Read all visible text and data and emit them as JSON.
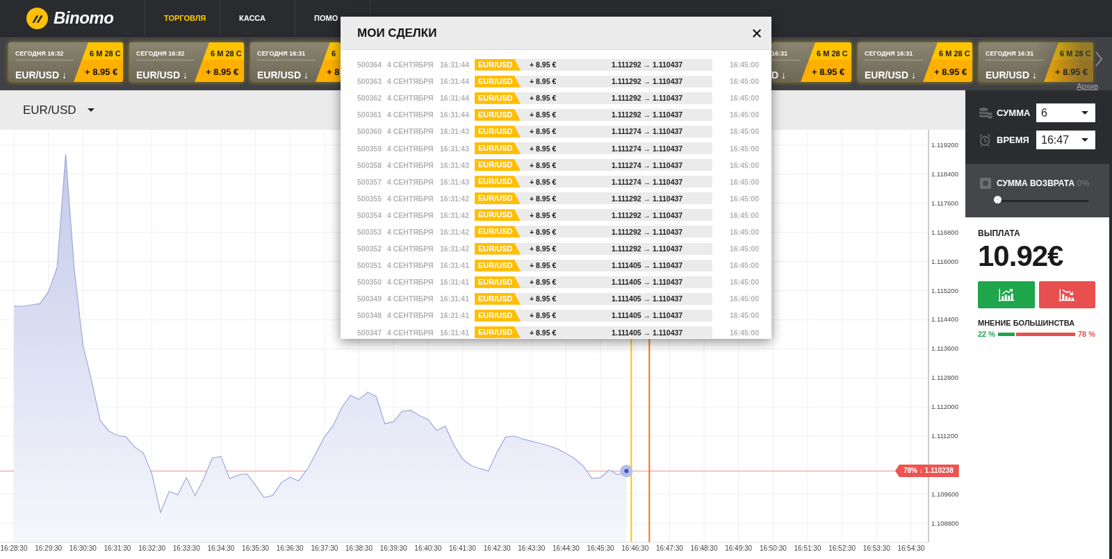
{
  "nav": {
    "logo": "Binomo",
    "items": [
      {
        "label": "ТОРГОВЛЯ",
        "selected": true
      },
      {
        "label": "КАССА",
        "selected": false
      },
      {
        "label": "ПОМО",
        "selected": false
      }
    ]
  },
  "ticker": {
    "left_cards": [
      {
        "kind": "full",
        "date": "СЕГОДНЯ 16:32",
        "timer": "6 М 28 С",
        "pair": "EUR/USD ↓",
        "profit": "+ 8.95 €"
      },
      {
        "kind": "full",
        "date": "СЕГОДНЯ 16:32",
        "timer": "6 М 28 С",
        "pair": "EUR/USD ↓",
        "profit": "+ 8.95 €"
      },
      {
        "kind": "clip-right",
        "date": "СЕГОДНЯ 16:31",
        "timer": "6",
        "pair": "EUR/USD ↓",
        "profit": "+ 8"
      }
    ],
    "right_cards": [
      {
        "kind": "clip-left",
        "date": "16:31",
        "timer": "6 М 28 С",
        "pair": "D ↓",
        "profit": "+ 8.95 €"
      },
      {
        "kind": "full",
        "date": "СЕГОДНЯ 16:31",
        "timer": "6 М 28 С",
        "pair": "EUR/USD ↓",
        "profit": "+ 8.95 €"
      },
      {
        "kind": "full",
        "date": "СЕГОДНЯ 16:31",
        "timer": "6 М 28 С",
        "pair": "EUR/USD ↓",
        "profit": "+ 8.95 €"
      }
    ],
    "archive_link": "Архив"
  },
  "asset_select": {
    "value": "EUR/USD"
  },
  "chart": {
    "chart_data": {
      "type": "area",
      "categories": [
        "16:28:30",
        null,
        null,
        null,
        "16:29:30",
        null,
        null,
        null,
        "16:30:30",
        null,
        null,
        null,
        "16:31:30",
        null,
        null,
        null,
        "16:32:30",
        null,
        null,
        null,
        "16:33:30",
        null,
        null,
        null,
        "16:34:30",
        null,
        null,
        null,
        "16:35:30",
        null,
        null,
        null,
        "16:36:30",
        null,
        null,
        null,
        "16:37:30",
        null,
        null,
        null,
        "16:38:30",
        null,
        null,
        null,
        "16:39:30",
        null,
        null,
        null,
        "16:40:30",
        null,
        null,
        null,
        "16:41:30",
        null,
        null,
        null,
        "16:42:30",
        null,
        null,
        null,
        "16:43:30",
        null,
        null,
        null,
        "16:44:30",
        null,
        null,
        null,
        "16:45:30",
        null,
        null,
        null,
        "16:46:30",
        null,
        null,
        null,
        "16:47:30",
        null,
        null,
        null,
        "16:48:30",
        null,
        null,
        null,
        "16:49:30",
        null,
        null,
        null,
        "16:50:30",
        null,
        null,
        null,
        "16:51:30",
        null,
        null,
        null,
        "16:52:30",
        null,
        null,
        null,
        "16:53:30",
        null,
        null,
        null,
        "16:54:30"
      ],
      "series": [
        {
          "color": "#9fa8da",
          "values": [
            1.11478,
            1.11477,
            1.11481,
            1.11484,
            1.11517,
            1.11583,
            1.11895,
            1.11579,
            1.11371,
            1.11273,
            1.11163,
            1.11134,
            1.11122,
            1.11118,
            1.1109,
            1.11074,
            1.11016,
            1.1091,
            1.10968,
            1.10959,
            1.11006,
            1.10956,
            1.11003,
            1.1106,
            1.11064,
            1.11003,
            1.11013,
            1.11016,
            1.10985,
            1.10951,
            1.10957,
            1.10992,
            1.11007,
            1.10997,
            1.11028,
            1.11073,
            1.11118,
            1.11149,
            1.11198,
            1.11233,
            1.11221,
            1.11241,
            1.11229,
            1.11154,
            1.1116,
            1.11188,
            1.11191,
            1.11177,
            1.11166,
            1.11136,
            1.11147,
            1.11096,
            1.11057,
            1.11039,
            1.11031,
            1.11024,
            1.11075,
            1.11118,
            1.1112,
            1.11112,
            1.11106,
            1.111,
            1.11094,
            1.11085,
            1.11073,
            1.11058,
            1.11037,
            1.11004,
            1.11006,
            1.11027,
            1.11014,
            1.11024,
            null,
            null,
            null,
            null,
            null,
            null,
            null,
            null,
            null,
            null,
            null,
            null,
            null,
            null,
            null,
            null,
            null,
            null,
            null,
            null,
            null,
            null,
            null,
            null,
            null,
            null,
            null,
            null,
            null,
            null,
            null,
            null,
            null
          ]
        }
      ],
      "ylim": [
        1.10828,
        1.11962
      ],
      "grid": true,
      "ref_lines": [
        {
          "axis": "y",
          "value": 1.110238
        }
      ],
      "yticks": [
        {
          "value": 1.1192,
          "label": "1.119200"
        },
        {
          "value": 1.1184,
          "label": "1.118400"
        },
        {
          "value": 1.1176,
          "label": "1.117600"
        },
        {
          "value": 1.1168,
          "label": "1.116800"
        },
        {
          "value": 1.116,
          "label": "1.116000"
        },
        {
          "value": 1.1152,
          "label": "1.115200"
        },
        {
          "value": 1.1144,
          "label": "1.114400"
        },
        {
          "value": 1.1136,
          "label": "1.113600"
        },
        {
          "value": 1.1128,
          "label": "1.112800"
        },
        {
          "value": 1.112,
          "label": "1.112000"
        },
        {
          "value": 1.1112,
          "label": "1.111200"
        },
        {
          "value": 1.1096,
          "label": "1.109600"
        },
        {
          "value": 1.1088,
          "label": "1.108800"
        }
      ]
    },
    "price_badge": "78% ↓ 1.110238"
  },
  "trades_dialog": {
    "title": "МОИ СДЕЛКИ",
    "rows": [
      {
        "id": "500364",
        "date": "4 СЕНТЯБРЯ",
        "time": "16:31:44",
        "pair": "EUR/USD",
        "profit": "+ 8.95 €",
        "rate": "1.111292 → 1.110437",
        "expiry": "16:45:00"
      },
      {
        "id": "500363",
        "date": "4 СЕНТЯБРЯ",
        "time": "16:31:44",
        "pair": "EUR/USD",
        "profit": "+ 8.95 €",
        "rate": "1.111292 → 1.110437",
        "expiry": "16:45:00"
      },
      {
        "id": "500362",
        "date": "4 СЕНТЯБРЯ",
        "time": "16:31:44",
        "pair": "EUR/USD",
        "profit": "+ 8.95 €",
        "rate": "1.111292 → 1.110437",
        "expiry": "16:45:00"
      },
      {
        "id": "500361",
        "date": "4 СЕНТЯБРЯ",
        "time": "16:31:44",
        "pair": "EUR/USD",
        "profit": "+ 8.95 €",
        "rate": "1.111292 → 1.110437",
        "expiry": "16:45:00"
      },
      {
        "id": "500360",
        "date": "4 СЕНТЯБРЯ",
        "time": "16:31:43",
        "pair": "EUR/USD",
        "profit": "+ 8.95 €",
        "rate": "1.111274 → 1.110437",
        "expiry": "16:45:00"
      },
      {
        "id": "500359",
        "date": "4 СЕНТЯБРЯ",
        "time": "16:31:43",
        "pair": "EUR/USD",
        "profit": "+ 8.95 €",
        "rate": "1.111274 → 1.110437",
        "expiry": "16:45:00"
      },
      {
        "id": "500358",
        "date": "4 СЕНТЯБРЯ",
        "time": "16:31:43",
        "pair": "EUR/USD",
        "profit": "+ 8.95 €",
        "rate": "1.111274 → 1.110437",
        "expiry": "16:45:00"
      },
      {
        "id": "500357",
        "date": "4 СЕНТЯБРЯ",
        "time": "16:31:43",
        "pair": "EUR/USD",
        "profit": "+ 8.95 €",
        "rate": "1.111274 → 1.110437",
        "expiry": "16:45:00"
      },
      {
        "id": "500355",
        "date": "4 СЕНТЯБРЯ",
        "time": "16:31:42",
        "pair": "EUR/USD",
        "profit": "+ 8.95 €",
        "rate": "1.111292 → 1.110437",
        "expiry": "16:45:00"
      },
      {
        "id": "500354",
        "date": "4 СЕНТЯБРЯ",
        "time": "16:31:42",
        "pair": "EUR/USD",
        "profit": "+ 8.95 €",
        "rate": "1.111292 → 1.110437",
        "expiry": "16:45:00"
      },
      {
        "id": "500353",
        "date": "4 СЕНТЯБРЯ",
        "time": "16:31:42",
        "pair": "EUR/USD",
        "profit": "+ 8.95 €",
        "rate": "1.111292 → 1.110437",
        "expiry": "16:45:00"
      },
      {
        "id": "500352",
        "date": "4 СЕНТЯБРЯ",
        "time": "16:31:42",
        "pair": "EUR/USD",
        "profit": "+ 8.95 €",
        "rate": "1.111292 → 1.110437",
        "expiry": "16:45:00"
      },
      {
        "id": "500351",
        "date": "4 СЕНТЯБРЯ",
        "time": "16:31:41",
        "pair": "EUR/USD",
        "profit": "+ 8.95 €",
        "rate": "1.111405 → 1.110437",
        "expiry": "16:45:00"
      },
      {
        "id": "500350",
        "date": "4 СЕНТЯБРЯ",
        "time": "16:31:41",
        "pair": "EUR/USD",
        "profit": "+ 8.95 €",
        "rate": "1.111405 → 1.110437",
        "expiry": "16:45:00"
      },
      {
        "id": "500349",
        "date": "4 СЕНТЯБРЯ",
        "time": "16:31:41",
        "pair": "EUR/USD",
        "profit": "+ 8.95 €",
        "rate": "1.111405 → 1.110437",
        "expiry": "16:45:00"
      },
      {
        "id": "500348",
        "date": "4 СЕНТЯБРЯ",
        "time": "16:31:41",
        "pair": "EUR/USD",
        "profit": "+ 8.95 €",
        "rate": "1.111405 → 1.110437",
        "expiry": "16:45:00"
      },
      {
        "id": "500347",
        "date": "4 СЕНТЯБРЯ",
        "time": "16:31:41",
        "pair": "EUR/USD",
        "profit": "+ 8.95 €",
        "rate": "1.111405 → 1.110437",
        "expiry": "16:45:00"
      }
    ]
  },
  "panel": {
    "amount": {
      "label": "СУММА",
      "value": "6"
    },
    "time": {
      "label": "ВРЕМЯ",
      "value": "16:47"
    },
    "refund": {
      "label": "СУММА ВОЗВРАТА",
      "percent": "0%",
      "level": 0
    },
    "payout": {
      "label": "ВЫПЛАТА",
      "value": "10.92€"
    },
    "opinion": {
      "label": "МНЕНИЕ БОЛЬШИНСТВА",
      "up": "22 %",
      "down": "78 %",
      "level": 0.22
    }
  }
}
